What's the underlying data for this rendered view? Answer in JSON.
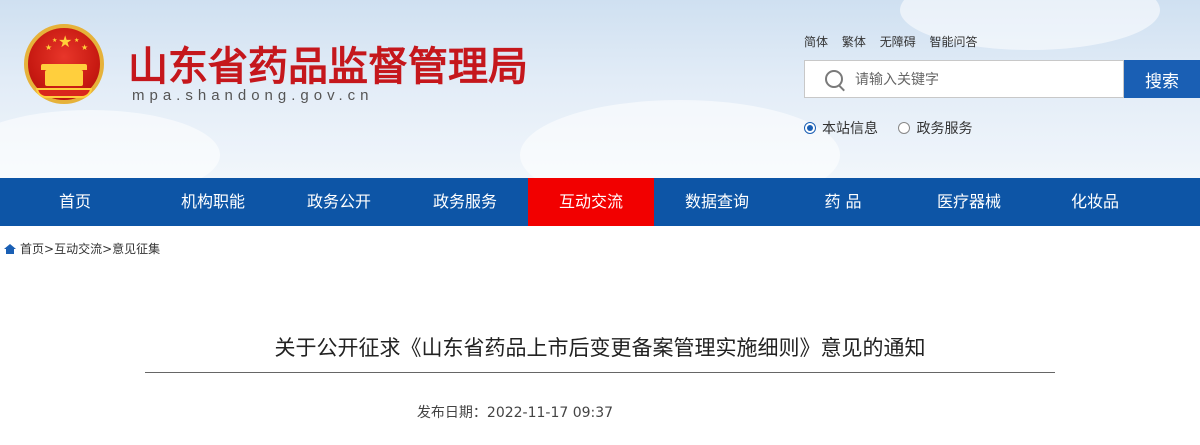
{
  "site": {
    "title": "山东省药品监督管理局",
    "url": "mpa.shandong.gov.cn"
  },
  "tools": [
    "简体",
    "繁体",
    "无障碍",
    "智能问答"
  ],
  "search": {
    "placeholder": "请输入关键字",
    "button_label": "搜索",
    "scopes": [
      {
        "label": "本站信息",
        "selected": true
      },
      {
        "label": "政务服务",
        "selected": false
      }
    ]
  },
  "nav": {
    "items": [
      "首页",
      "机构职能",
      "政务公开",
      "政务服务",
      "互动交流",
      "数据查询",
      "药 品",
      "医疗器械",
      "化妆品"
    ],
    "active_item": "互动交流"
  },
  "breadcrumb": [
    "首页",
    ">",
    "互动交流",
    ">",
    "意见征集"
  ],
  "article": {
    "title": "关于公开征求《山东省药品上市后变更备案管理实施细则》意见的通知",
    "publish_date": "发布日期：2022-11-17 09:37"
  },
  "colors": {
    "brand_red": "#c5171c",
    "nav_blue": "#0d55a6",
    "nav_active": "#f20000",
    "search_blue": "#1a5fb4"
  },
  "icons": [
    "national-emblem-icon",
    "search-icon",
    "home-icon"
  ]
}
